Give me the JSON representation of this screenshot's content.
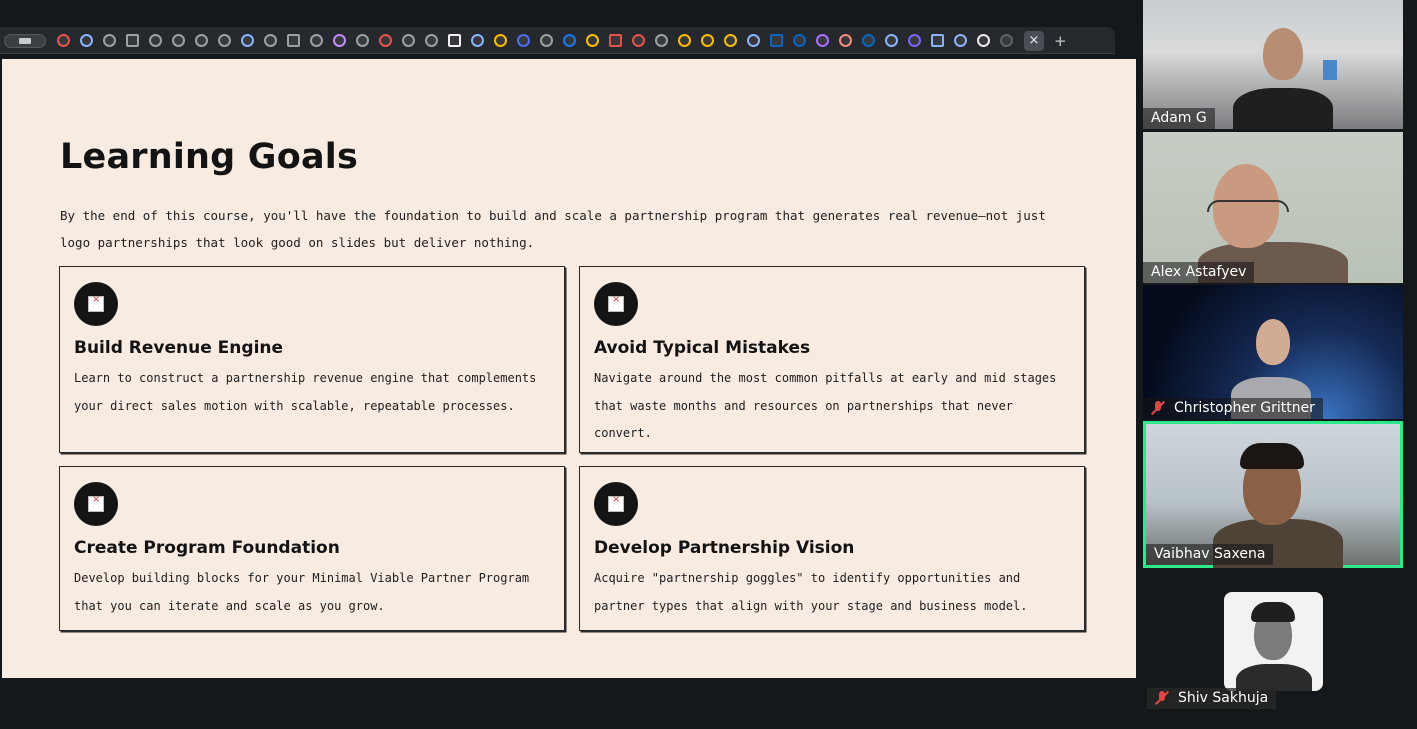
{
  "browser": {
    "favicon_colors": [
      "#e5534b",
      "#8ab4f8",
      "#9aa0a6",
      "#9aa0a6",
      "#9aa0a6",
      "#9aa0a6",
      "#9aa0a6",
      "#9aa0a6",
      "#8ab4f8",
      "#9aa0a6",
      "#9aa0a6",
      "#9aa0a6",
      "#c58af9",
      "#9aa0a6",
      "#e5534b",
      "#9aa0a6",
      "#9aa0a6",
      "#f1f3f4",
      "#8ab4f8",
      "#fbbc04",
      "#4c6ef5",
      "#9aa0a6",
      "#1877f2",
      "#fbbc04",
      "#e5534b",
      "#e5534b",
      "#9aa0a6",
      "#fbbc04",
      "#fbbc04",
      "#fbbc04",
      "#8ab4f8",
      "#0a66c2",
      "#0a66c2",
      "#a970ff",
      "#f28b82",
      "#0a66c2",
      "#8ab4f8",
      "#7b61ff",
      "#8ab4f8",
      "#8ab4f8",
      "#e8eaed",
      "#5f6368"
    ],
    "active_tab_icon": "close-icon",
    "new_tab_icon": "plus-icon",
    "active_tab_close": "×",
    "new_tab_label": "+"
  },
  "slide": {
    "title": "Learning Goals",
    "intro": "By the end of this course, you'll have the foundation to build and scale a partnership program that generates real revenue—not just logo partnerships that look good on slides but deliver nothing.",
    "cards": [
      {
        "title": "Build Revenue Engine",
        "description": "Learn to construct a partnership revenue engine that complements your direct sales motion with scalable, repeatable processes.",
        "icon": "broken-image-icon"
      },
      {
        "title": "Avoid Typical Mistakes",
        "description": "Navigate around the most common pitfalls at early and mid stages that waste months and resources on partnerships that never convert.",
        "icon": "broken-image-icon"
      },
      {
        "title": "Create Program Foundation",
        "description": "Develop building blocks for your Minimal Viable Partner Program that you can iterate and scale as you grow.",
        "icon": "broken-image-icon"
      },
      {
        "title": "Develop Partnership Vision",
        "description": "Acquire \"partnership goggles\" to identify opportunities and partner types that align with your stage and business model.",
        "icon": "broken-image-icon"
      }
    ]
  },
  "participants": [
    {
      "name": "Adam G",
      "muted": false,
      "speaking": false
    },
    {
      "name": "Alex Astafyev",
      "muted": false,
      "speaking": false
    },
    {
      "name": "Christopher Grittner",
      "muted": true,
      "speaking": false
    },
    {
      "name": "Vaibhav Saxena",
      "muted": false,
      "speaking": true
    },
    {
      "name": "Shiv Sakhuja",
      "muted": true,
      "speaking": false
    }
  ],
  "colors": {
    "slide_bg": "#f8ebe2",
    "speaking_border": "#2ee88a",
    "muted_icon": "#e04848"
  }
}
